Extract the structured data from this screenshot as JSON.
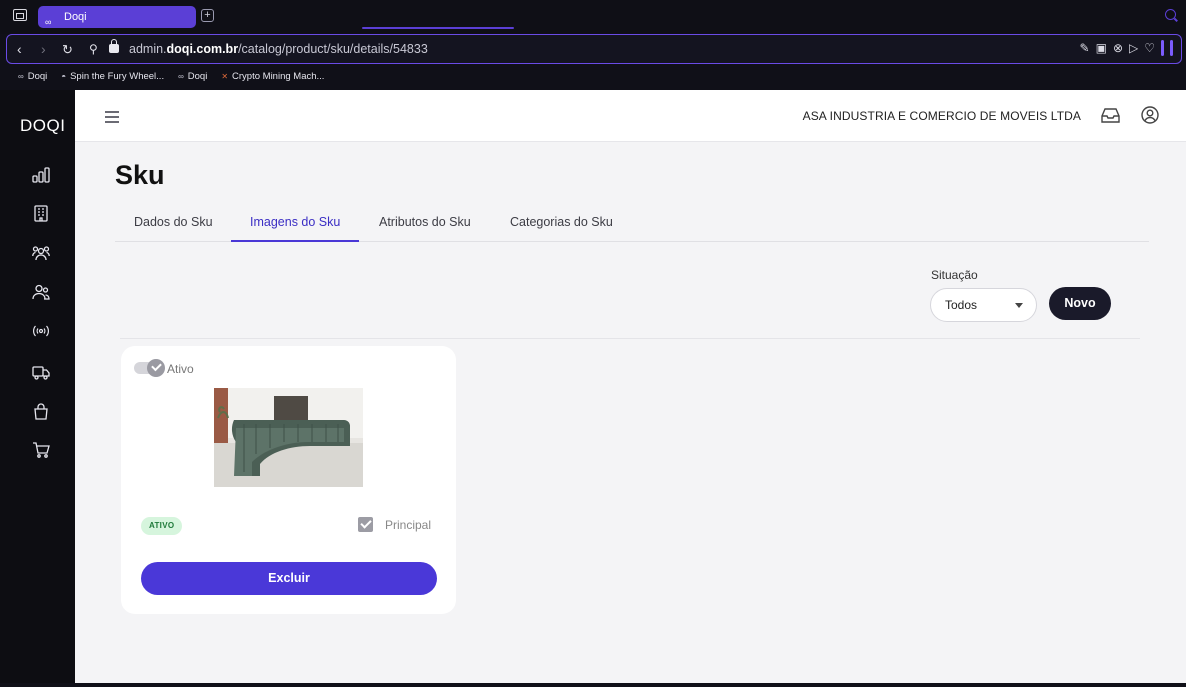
{
  "browser": {
    "tab_title": "Doqi",
    "tab_favicon": "∞",
    "new_tab_label": "+",
    "url_prefix": "admin.",
    "url_domain": "doqi.com.br",
    "url_path": "/catalog/product/sku/details/54833",
    "bookmarks": [
      {
        "icon": "∞",
        "label": "Doqi"
      },
      {
        "icon": "◓",
        "label": "Spin the Fury Wheel..."
      },
      {
        "icon": "∞",
        "label": "Doqi"
      },
      {
        "icon": "✕",
        "label": "Crypto Mining Mach..."
      }
    ]
  },
  "sidebar": {
    "logo": "DOQI",
    "items": [
      "chart-icon",
      "building-icon",
      "users-group-icon",
      "users-icon",
      "broadcast-icon",
      "truck-icon",
      "bag-icon",
      "cart-icon"
    ]
  },
  "header": {
    "company": "ASA INDUSTRIA E COMERCIO DE MOVEIS LTDA"
  },
  "page": {
    "title": "Sku",
    "tabs": [
      "Dados do Sku",
      "Imagens do Sku",
      "Atributos do Sku",
      "Categorias do Sku"
    ],
    "active_tab": "Imagens do Sku"
  },
  "filter": {
    "label": "Situação",
    "selected": "Todos",
    "new_button": "Novo"
  },
  "image_card": {
    "toggle_label": "Ativo",
    "status_badge": "ATIVO",
    "principal_label": "Principal",
    "delete_button": "Excluir"
  },
  "colors": {
    "accent": "#4a38d8",
    "sidebar": "#0d0d12",
    "badge_bg": "#d6f5dd"
  }
}
